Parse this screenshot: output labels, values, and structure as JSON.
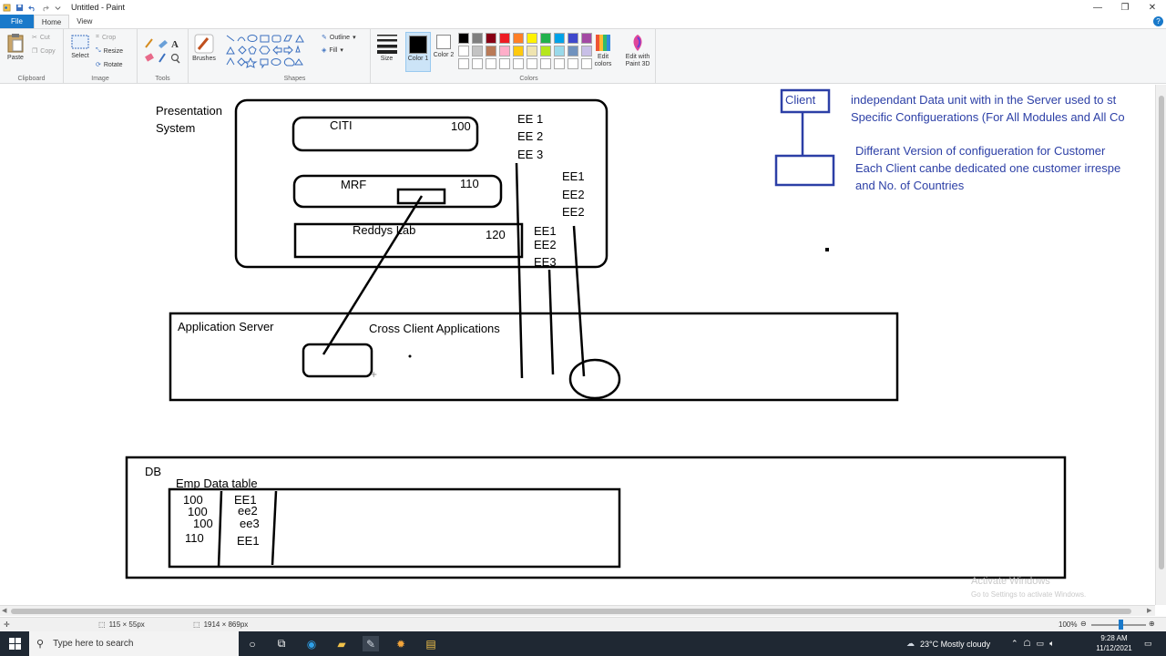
{
  "window": {
    "title": "Untitled - Paint",
    "controls": [
      "—",
      "❐",
      "✕"
    ]
  },
  "tabs": [
    {
      "label": "File"
    },
    {
      "label": "Home"
    },
    {
      "label": "View"
    }
  ],
  "ribbon": {
    "clipboard": {
      "paste": "Paste",
      "cut": "Cut",
      "copy": "Copy",
      "group": "Clipboard"
    },
    "image": {
      "select": "Select",
      "crop": "Crop",
      "resize": "Resize",
      "rotate": "Rotate",
      "group": "Image"
    },
    "tools": {
      "group": "Tools"
    },
    "brushes": {
      "label": "Brushes"
    },
    "shapes": {
      "outline": "Outline",
      "fill": "Fill",
      "group": "Shapes"
    },
    "size": {
      "label": "Size"
    },
    "color1": {
      "label": "Color 1"
    },
    "color2": {
      "label": "Color 2"
    },
    "edit_colors": "Edit colors",
    "edit_paint3d": "Edit with Paint 3D",
    "colors_group": "Colors",
    "palette": [
      "#000000",
      "#7f7f7f",
      "#880015",
      "#ed1c24",
      "#ff7f27",
      "#fff200",
      "#22b14c",
      "#00a2e8",
      "#3f48cc",
      "#a349a4",
      "#ffffff",
      "#c3c3c3",
      "#b97a57",
      "#ffaec9",
      "#ffc90e",
      "#efe4b0",
      "#b5e61d",
      "#99d9ea",
      "#7092be",
      "#c8bfe7",
      "#ffffff",
      "#ffffff",
      "#ffffff",
      "#ffffff",
      "#ffffff",
      "#ffffff",
      "#ffffff",
      "#ffffff",
      "#ffffff",
      "#ffffff"
    ]
  },
  "canvas_text": {
    "presentation_system": [
      "Presentation",
      "System"
    ],
    "citi": "CITI",
    "citi_num": "100",
    "mrf": "MRF",
    "mrf_num": "110",
    "reddys": "Reddys Lab",
    "reddys_num": "120",
    "ee_col1": [
      "EE 1",
      "EE 2",
      "EE 3"
    ],
    "ee_col2": [
      "EE1",
      "EE2",
      "EE2"
    ],
    "ee_col3": [
      "EE1",
      "EE2",
      "EE3"
    ],
    "application_server": "Application Server",
    "cross_client": "Cross Client Applications",
    "db": "DB",
    "emp_table": "Emp Data table",
    "table_nums": [
      "100",
      "100",
      "100",
      "110"
    ],
    "table_ees": [
      "EE1",
      "ee2",
      "ee3",
      "EE1"
    ],
    "client": "Client",
    "blue_note1": [
      "independant Data unit with in the Server used to st",
      "Specific Configuerations (For All Modules and All Co"
    ],
    "blue_note2": [
      "Differant Version of  configueration for Customer",
      "Each Client canbe dedicated one customer irrespe",
      "and No. of Countries"
    ]
  },
  "watermark": {
    "line1": "Activate Windows",
    "line2": "Go to Settings to activate Windows."
  },
  "statusbar": {
    "selection": "115 × 55px",
    "canvas_size": "1914 × 869px",
    "zoom": "100%"
  },
  "taskbar": {
    "search_placeholder": "Type here to search",
    "weather": "23°C  Mostly cloudy",
    "time": "9:28 AM",
    "date": "11/12/2021"
  }
}
